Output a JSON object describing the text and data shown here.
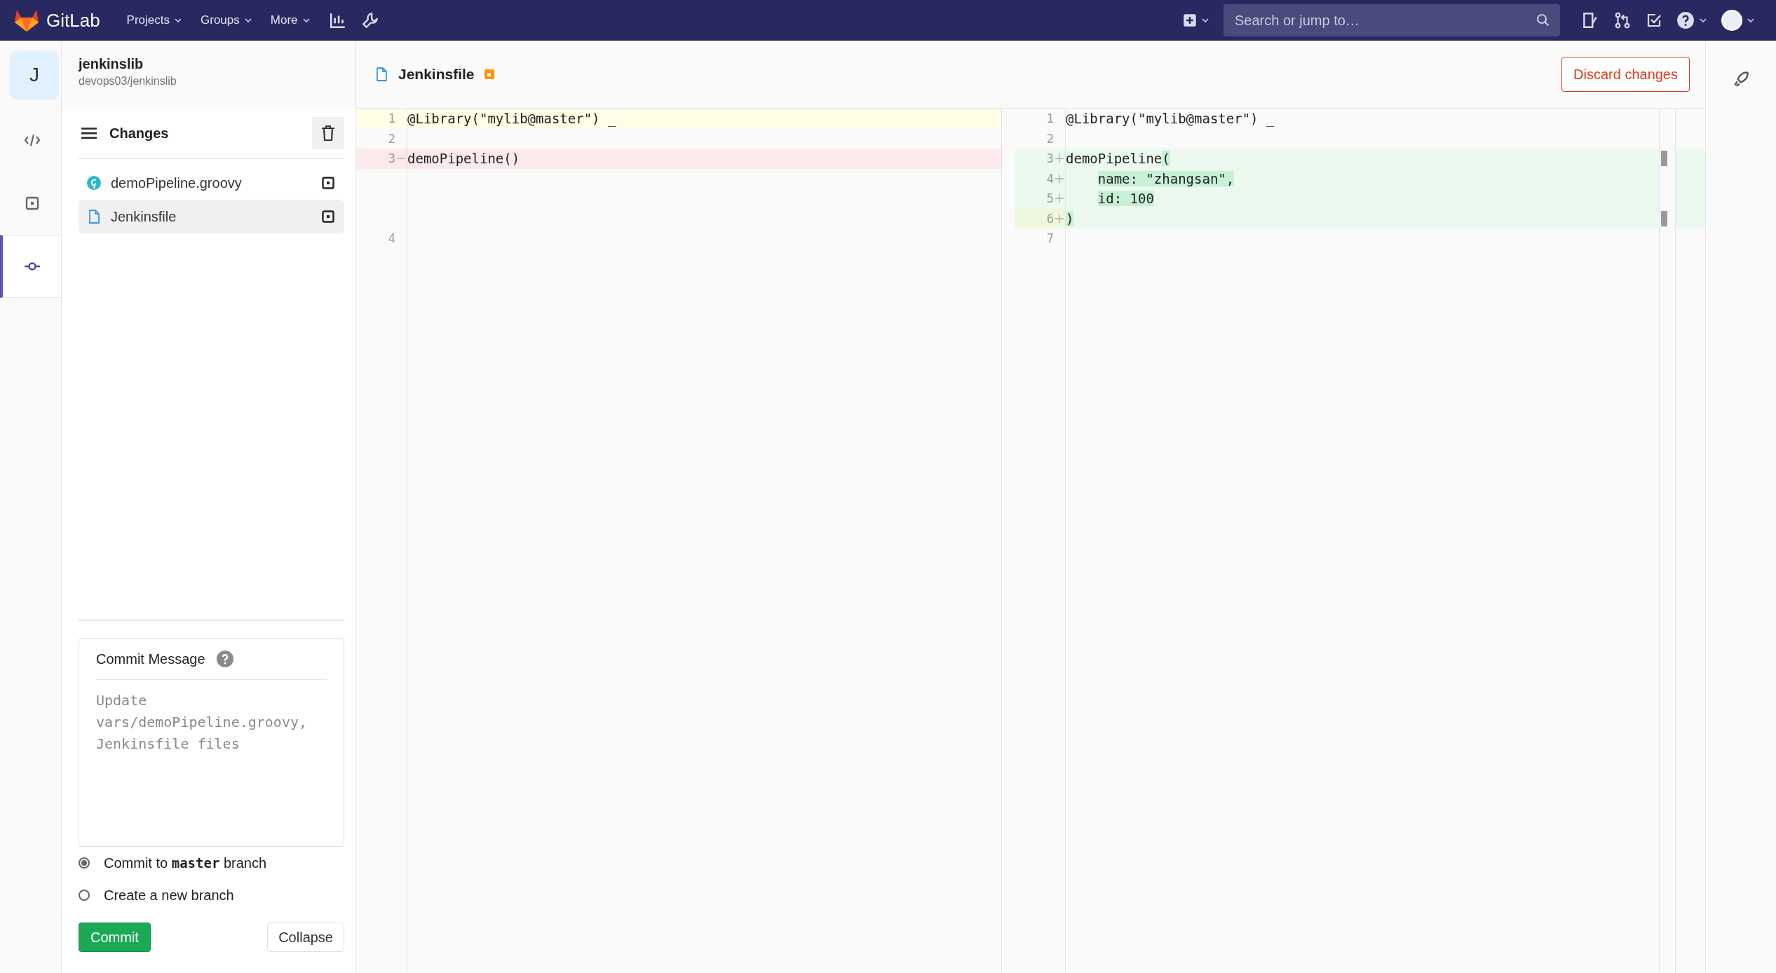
{
  "topbar": {
    "brand": "GitLab",
    "nav": [
      {
        "label": "Projects"
      },
      {
        "label": "Groups"
      },
      {
        "label": "More"
      }
    ],
    "search": {
      "placeholder": "Search or jump to…"
    }
  },
  "rail": [
    {
      "kind": "edit",
      "selected": false
    },
    {
      "kind": "review",
      "selected": false
    },
    {
      "kind": "commit",
      "selected": true
    }
  ],
  "project": {
    "avatar": "J",
    "name": "jenkinslib",
    "path": "devops03/jenkinslib"
  },
  "changes": {
    "title": "Changes",
    "files": [
      {
        "name": "demoPipeline.groovy",
        "kind": "groovy",
        "selected": false
      },
      {
        "name": "Jenkinsfile",
        "kind": "file",
        "selected": true
      }
    ]
  },
  "commit": {
    "label": "Commit Message",
    "placeholder": "Update vars/demoPipeline.groovy, Jenkinsfile files",
    "options": [
      {
        "label": "Commit to **master** branch",
        "selected": true
      },
      {
        "label": "Create a new branch",
        "selected": false
      }
    ],
    "buttons": [
      {
        "label": "Commit",
        "kind": "primary"
      },
      {
        "label": "Collapse",
        "kind": "default"
      }
    ]
  },
  "editor": {
    "file": {
      "name": "Jenkinsfile",
      "modified": true
    },
    "discard": "Discard changes",
    "original": [
      {
        "number": "1",
        "kind": "normal",
        "current": true,
        "segments": [
          {
            "text": "@Library(\"mylib@master\") _",
            "changed": false
          }
        ]
      },
      {
        "number": "2",
        "kind": "normal",
        "current": false
      },
      {
        "number": "3",
        "kind": "deleted",
        "current": false,
        "segments": [
          {
            "text": "demoPipeline()",
            "changed": false
          }
        ]
      },
      {
        "kind": "gap"
      },
      {
        "kind": "gap"
      },
      {
        "kind": "gap"
      },
      {
        "number": "4",
        "kind": "normal",
        "current": false
      }
    ],
    "modified": [
      {
        "number": "1",
        "kind": "normal",
        "current": false,
        "segments": [
          {
            "text": "@Library(\"mylib@master\") _",
            "changed": false
          }
        ]
      },
      {
        "number": "2",
        "kind": "normal",
        "current": false
      },
      {
        "number": "3",
        "kind": "added",
        "current": false,
        "segments": [
          {
            "text": "demoPipeline",
            "changed": false
          },
          {
            "text": "(",
            "changed": true
          }
        ]
      },
      {
        "number": "4",
        "kind": "added",
        "current": false,
        "segments": [
          {
            "text": "name: \"zhangsan\",",
            "changed": true,
            "indented": true
          }
        ]
      },
      {
        "number": "5",
        "kind": "added",
        "current": false,
        "segments": [
          {
            "text": "id: 100",
            "changed": true,
            "indented": true
          }
        ]
      },
      {
        "number": "6",
        "kind": "added",
        "current": true,
        "segments": [
          {
            "text": ")",
            "changed": true
          }
        ]
      },
      {
        "number": "7",
        "kind": "normal",
        "current": false
      }
    ]
  }
}
